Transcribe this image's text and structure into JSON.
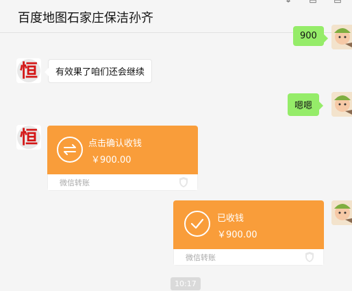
{
  "header": {
    "title": "百度地图石家庄保洁孙齐",
    "controls": [
      "pin-icon",
      "minimize-icon",
      "close-icon"
    ]
  },
  "messages": {
    "m1": {
      "text": "900"
    },
    "m2": {
      "text": "有效果了咱们还会继续"
    },
    "m3": {
      "text": "嗯嗯"
    },
    "transfer_incoming": {
      "title": "点击确认收钱",
      "amount": "￥900.00",
      "footer": "微信转账",
      "icon": "swap-arrows-icon"
    },
    "transfer_received": {
      "title": "已收钱",
      "amount": "￥900.00",
      "footer": "微信转账",
      "icon": "check-circle-icon"
    },
    "timestamp": "10:17"
  },
  "colors": {
    "background": "#f5f5f5",
    "green_bubble": "#95ec69",
    "transfer_orange": "#f99d3a",
    "avatar_left_red": "#d41616"
  }
}
